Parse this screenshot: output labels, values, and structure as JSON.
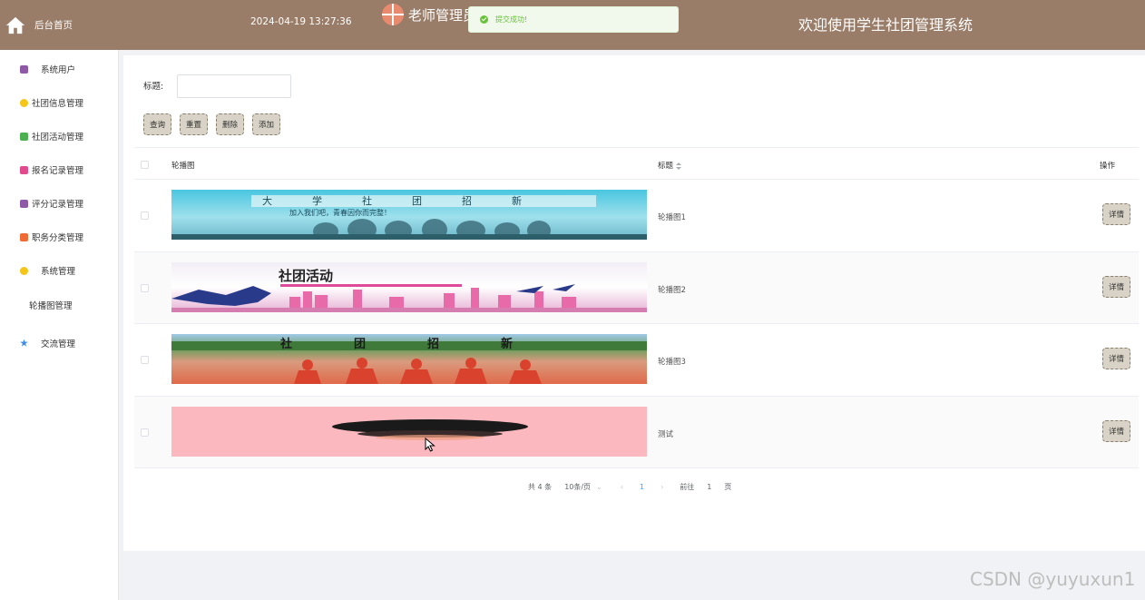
{
  "header": {
    "home_label": "后台首页",
    "datetime": "2024-04-19 13:27:36",
    "role": "老师管理员",
    "welcome": "欢迎使用学生社团管理系统",
    "bg_color": "#997d68"
  },
  "toast": {
    "text": "提交成功!",
    "type": "success",
    "icon": "check-circle-icon"
  },
  "sidebar": {
    "items": [
      {
        "label": "系统用户",
        "icon": "user-icon"
      },
      {
        "label": "社团信息管理",
        "icon": "info-icon"
      },
      {
        "label": "社团活动管理",
        "icon": "chat-icon"
      },
      {
        "label": "报名记录管理",
        "icon": "form-icon"
      },
      {
        "label": "评分记录管理",
        "icon": "score-icon"
      },
      {
        "label": "职务分类管理",
        "icon": "grid-icon"
      },
      {
        "label": "系统管理",
        "icon": "settings-icon"
      },
      {
        "label": "轮播图管理",
        "icon": ""
      },
      {
        "label": "交流管理",
        "icon": "star-icon"
      }
    ]
  },
  "search": {
    "label": "标题:",
    "value": ""
  },
  "toolbar": {
    "query": "查询",
    "reset": "重置",
    "delete": "删除",
    "add": "添加"
  },
  "table": {
    "headers": {
      "image": "轮播图",
      "title": "标题",
      "actions": "操作"
    },
    "rows": [
      {
        "image_text": "大学社团招新",
        "image_sub": "加入我们吧，青春因你而完整！",
        "title": "轮播图1"
      },
      {
        "image_text": "社团活动",
        "title": "轮播图2"
      },
      {
        "image_text": "社团招新",
        "title": "轮播图3"
      },
      {
        "image_text": "",
        "title": "测试"
      }
    ],
    "detail_label": "详情"
  },
  "pagination": {
    "total": "共 4 条",
    "page_size": "10条/页",
    "current": "1",
    "goto": "前往",
    "goto_value": "1",
    "page_unit": "页"
  },
  "watermark": "CSDN @yuyuxun1"
}
